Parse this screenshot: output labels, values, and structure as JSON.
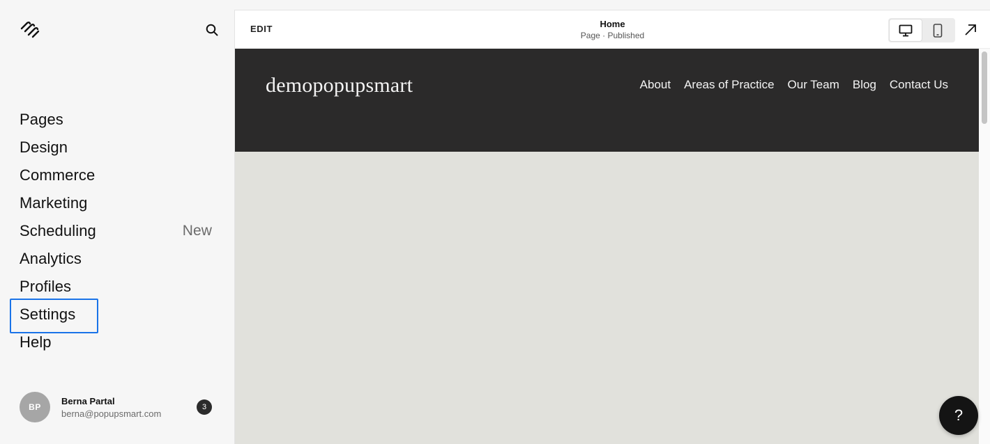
{
  "sidebar": {
    "logo": "squarespace-logo",
    "search": "search-icon",
    "nav": [
      {
        "label": "Pages",
        "badge": ""
      },
      {
        "label": "Design",
        "badge": ""
      },
      {
        "label": "Commerce",
        "badge": ""
      },
      {
        "label": "Marketing",
        "badge": ""
      },
      {
        "label": "Scheduling",
        "badge": "New"
      },
      {
        "label": "Analytics",
        "badge": ""
      },
      {
        "label": "Profiles",
        "badge": ""
      },
      {
        "label": "Settings",
        "badge": "",
        "selected": true
      },
      {
        "label": "Help",
        "badge": ""
      }
    ],
    "user": {
      "initials": "BP",
      "name": "Berna Partal",
      "email": "berna@popupsmart.com",
      "notifications": "3"
    }
  },
  "topbar": {
    "edit_label": "EDIT",
    "page_title": "Home",
    "page_status": "Page · Published",
    "views": [
      "desktop-icon",
      "mobile-icon"
    ],
    "open_icon": "arrow-up-right-icon"
  },
  "site": {
    "title": "demopopupsmart",
    "nav": [
      "About",
      "Areas of Practice",
      "Our Team",
      "Blog",
      "Contact Us"
    ]
  },
  "help": {
    "label": "?"
  },
  "colors": {
    "sidebar_bg": "#f6f6f6",
    "site_header_bg": "#2b2a2a",
    "site_body_bg": "#e1e1dc",
    "selection_outline": "#1a73e8"
  }
}
